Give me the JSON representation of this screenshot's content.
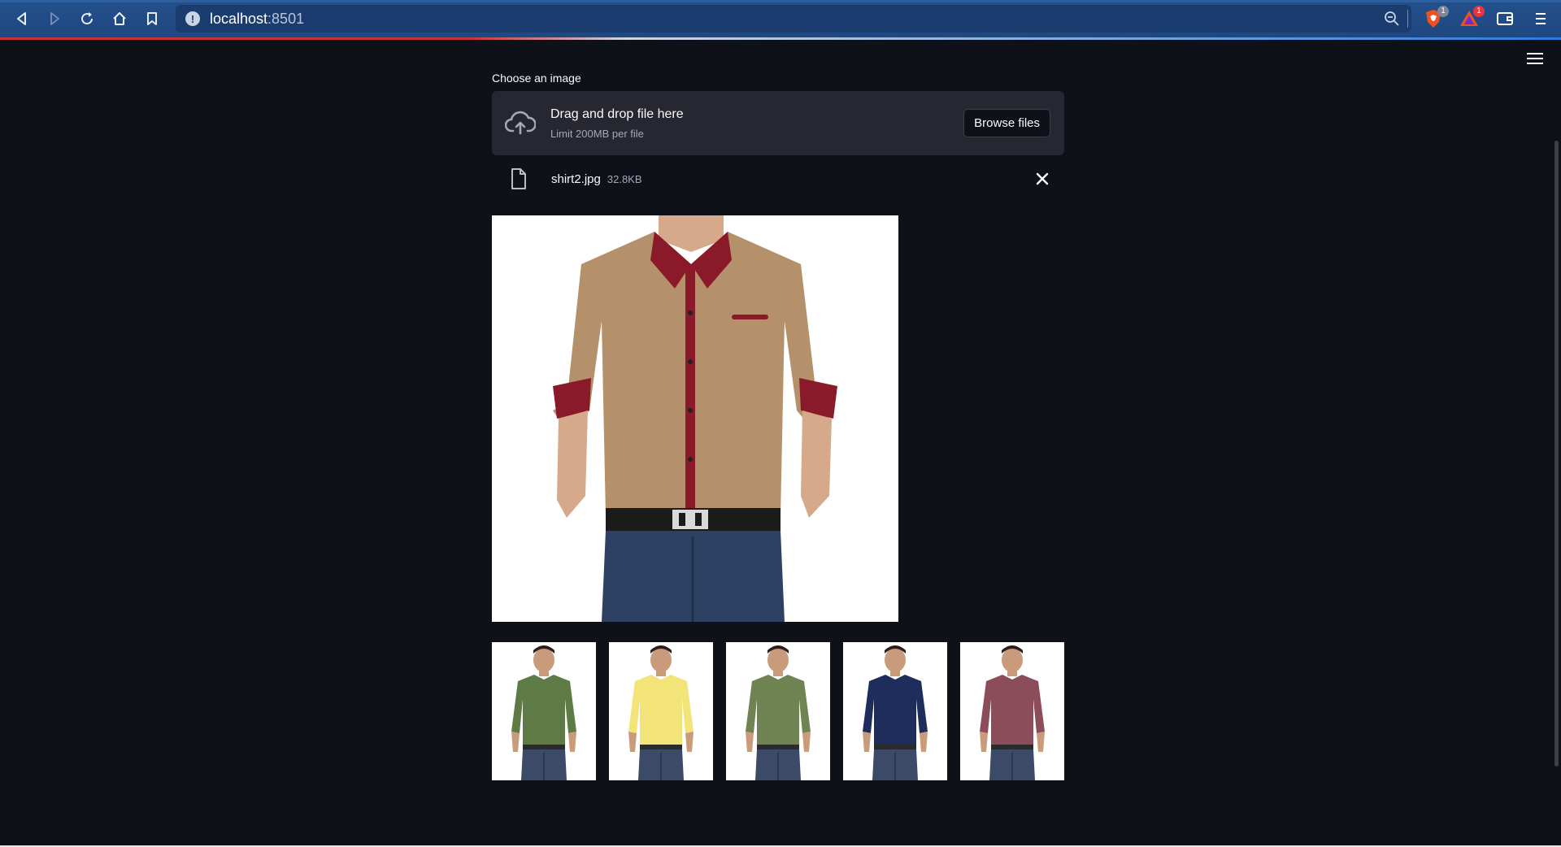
{
  "browser": {
    "url_host": "localhost",
    "url_port": ":8501",
    "extensions": [
      {
        "name": "brave-shield-icon",
        "badge": "1"
      },
      {
        "name": "brave-rewards-icon",
        "badge": "1"
      }
    ]
  },
  "uploader": {
    "label": "Choose an image",
    "drop_title": "Drag and drop file here",
    "drop_limit": "Limit 200MB per file",
    "browse_label": "Browse files"
  },
  "file": {
    "name": "shirt2.jpg",
    "size": "32.8KB"
  },
  "uploaded_image": {
    "shirt_color": "#b5916b",
    "collar_color": "#8a1a2a"
  },
  "recommendations": [
    {
      "shirt_color": "#5e7a45"
    },
    {
      "shirt_color": "#f3e47a"
    },
    {
      "shirt_color": "#6f8452"
    },
    {
      "shirt_color": "#1f2d5c"
    },
    {
      "shirt_color": "#8c4d5a"
    }
  ],
  "colors": {
    "page_bg": "#0e1117",
    "dropzone_bg": "#262730",
    "chrome_bg": "#1f4780"
  }
}
